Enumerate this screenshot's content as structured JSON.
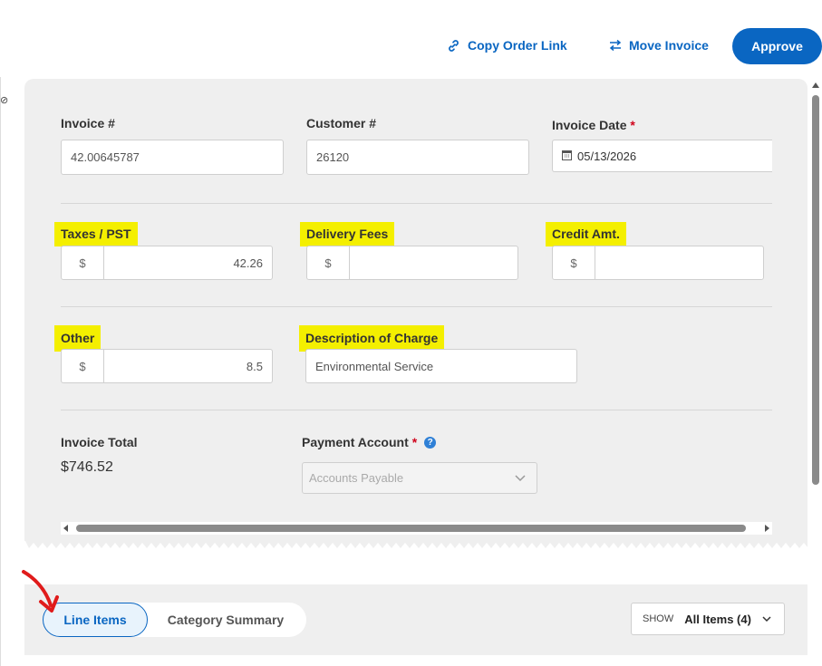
{
  "toolbar": {
    "copy_link_label": "Copy Order Link",
    "move_invoice_label": "Move Invoice",
    "approve_label": "Approve"
  },
  "form": {
    "invoice_number": {
      "label": "Invoice #",
      "value": "42.00645787"
    },
    "customer_number": {
      "label": "Customer #",
      "value": "26120"
    },
    "invoice_date": {
      "label": "Invoice Date",
      "required_mark": "*",
      "value": "05/13/2026"
    },
    "taxes": {
      "label": "Taxes / PST",
      "prefix": "$",
      "value": "42.26"
    },
    "delivery_fees": {
      "label": "Delivery Fees",
      "prefix": "$",
      "value": ""
    },
    "credit_amt": {
      "label": "Credit Amt.",
      "prefix": "$",
      "value": ""
    },
    "other": {
      "label": "Other",
      "prefix": "$",
      "value": "8.5"
    },
    "description": {
      "label": "Description of Charge",
      "value": "Environmental Service"
    },
    "invoice_total": {
      "label": "Invoice Total",
      "value": "$746.52"
    },
    "payment_account": {
      "label": "Payment Account",
      "required_mark": "*",
      "help": "?",
      "value": "Accounts Payable"
    }
  },
  "tabs": {
    "line_items": "Line Items",
    "category_summary": "Category Summary"
  },
  "show_filter": {
    "label": "SHOW",
    "value": "All Items (4)"
  },
  "colors": {
    "accent": "#0a66c2",
    "highlight": "#f4ef00",
    "required": "#d0021b",
    "annotation_arrow": "#e01b1b"
  }
}
